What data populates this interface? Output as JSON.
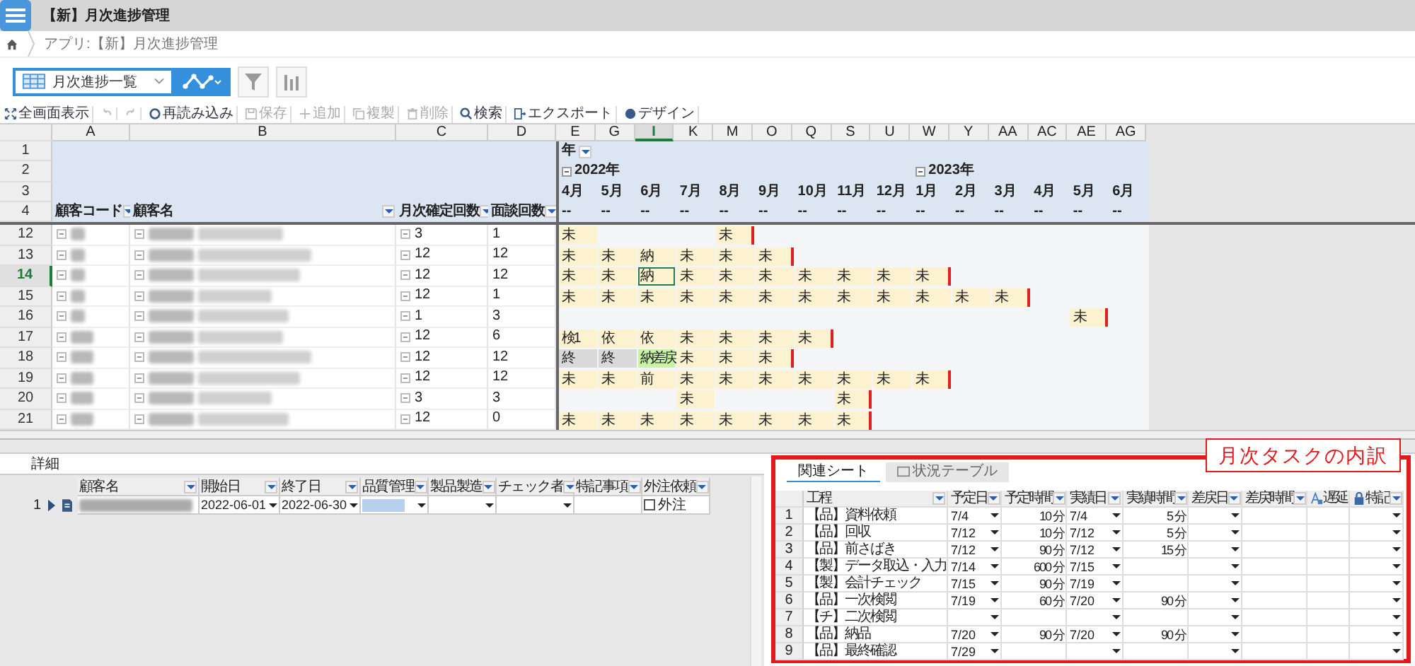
{
  "app": {
    "title": "【新】月次進捗管理",
    "breadcrumb": "アプリ:【新】月次進捗管理"
  },
  "view": {
    "name": "月次進捗一覧"
  },
  "toolbar": [
    {
      "kind": "expand",
      "label": "全画面表示",
      "disabled": false
    },
    {
      "kind": "undo",
      "disabled": true
    },
    {
      "kind": "redo",
      "disabled": true
    },
    {
      "kind": "reload",
      "label": "再読み込み",
      "disabled": false
    },
    {
      "kind": "save",
      "label": "保存",
      "disabled": true
    },
    {
      "kind": "add",
      "label": "追加",
      "disabled": true
    },
    {
      "kind": "copy",
      "label": "複製",
      "disabled": true
    },
    {
      "kind": "delete",
      "label": "削除",
      "disabled": true
    },
    {
      "kind": "search",
      "label": "検索",
      "disabled": false
    },
    {
      "kind": "export",
      "label": "エクスポート",
      "disabled": false
    },
    {
      "kind": "design",
      "label": "デザイン",
      "disabled": false
    }
  ],
  "sheet": {
    "header_rows": [
      "1",
      "2",
      "3",
      "4"
    ],
    "year_filter": "年",
    "fixed_columns": [
      {
        "letter": "A",
        "header": "顧客コード"
      },
      {
        "letter": "B",
        "header": "顧客名"
      },
      {
        "letter": "C",
        "header": "月次確定回数"
      },
      {
        "letter": "D",
        "header": "面談回数"
      }
    ],
    "month_columns": [
      {
        "letter": "E",
        "year": "2022年",
        "month": "4月",
        "sub": "--",
        "selected": false
      },
      {
        "letter": "G",
        "month": "5月",
        "sub": "--",
        "selected": false
      },
      {
        "letter": "I",
        "month": "6月",
        "sub": "--",
        "selected": true
      },
      {
        "letter": "K",
        "month": "7月",
        "sub": "--",
        "selected": false
      },
      {
        "letter": "M",
        "month": "8月",
        "sub": "--",
        "selected": false
      },
      {
        "letter": "O",
        "month": "9月",
        "sub": "--",
        "selected": false
      },
      {
        "letter": "Q",
        "month": "10月",
        "sub": "--",
        "selected": false
      },
      {
        "letter": "S",
        "month": "11月",
        "sub": "--",
        "selected": false
      },
      {
        "letter": "U",
        "month": "12月",
        "sub": "--",
        "selected": false
      },
      {
        "letter": "W",
        "year": "2023年",
        "month": "1月",
        "sub": "--",
        "selected": false
      },
      {
        "letter": "Y",
        "month": "2月",
        "sub": "--",
        "selected": false
      },
      {
        "letter": "AA",
        "month": "3月",
        "sub": "--",
        "selected": false
      },
      {
        "letter": "AC",
        "month": "4月",
        "sub": "--",
        "selected": false
      },
      {
        "letter": "AE",
        "month": "5月",
        "sub": "--",
        "selected": false
      },
      {
        "letter": "AG",
        "month": "6月",
        "sub": "--",
        "selected": false
      }
    ],
    "rows": [
      {
        "number": "12",
        "selected": false,
        "count": "3",
        "interviews": "1",
        "cells": [
          {
            "text": "未",
            "color": "#fdf2d0"
          },
          null,
          null,
          null,
          {
            "text": "未",
            "color": "#fdf2d0"
          },
          null,
          null,
          null,
          null,
          null,
          null,
          null,
          null,
          null,
          null
        ]
      },
      {
        "number": "13",
        "selected": false,
        "count": "12",
        "interviews": "12",
        "cells": [
          {
            "text": "未",
            "color": "#fdf2d0"
          },
          {
            "text": "未",
            "color": "#fdf2d0"
          },
          {
            "text": "納",
            "color": "#fdf2d0"
          },
          {
            "text": "未",
            "color": "#fdf2d0"
          },
          {
            "text": "未",
            "color": "#fdf2d0"
          },
          {
            "text": "未",
            "color": "#fdf2d0"
          },
          null,
          null,
          null,
          null,
          null,
          null,
          null,
          null,
          null
        ]
      },
      {
        "number": "14",
        "selected": true,
        "count": "12",
        "interviews": "12",
        "cells": [
          {
            "text": "未",
            "color": "#fdf2d0"
          },
          {
            "text": "未",
            "color": "#fdf2d0"
          },
          {
            "text": "納",
            "color": "#fdf2d0"
          },
          {
            "text": "未",
            "color": "#fdf2d0"
          },
          {
            "text": "未",
            "color": "#fdf2d0"
          },
          {
            "text": "未",
            "color": "#fdf2d0"
          },
          {
            "text": "未",
            "color": "#fdf2d0"
          },
          {
            "text": "未",
            "color": "#fdf2d0"
          },
          {
            "text": "未",
            "color": "#fdf2d0"
          },
          {
            "text": "未",
            "color": "#fdf2d0"
          },
          null,
          null,
          null,
          null,
          null
        ]
      },
      {
        "number": "15",
        "selected": false,
        "count": "12",
        "interviews": "1",
        "cells": [
          {
            "text": "未",
            "color": "#fdf2d0"
          },
          {
            "text": "未",
            "color": "#fdf2d0"
          },
          {
            "text": "未",
            "color": "#fdf2d0"
          },
          {
            "text": "未",
            "color": "#fdf2d0"
          },
          {
            "text": "未",
            "color": "#fdf2d0"
          },
          {
            "text": "未",
            "color": "#fdf2d0"
          },
          {
            "text": "未",
            "color": "#fdf2d0"
          },
          {
            "text": "未",
            "color": "#fdf2d0"
          },
          {
            "text": "未",
            "color": "#fdf2d0"
          },
          {
            "text": "未",
            "color": "#fdf2d0"
          },
          {
            "text": "未",
            "color": "#fdf2d0"
          },
          {
            "text": "未",
            "color": "#fdf2d0"
          },
          null,
          null,
          null
        ]
      },
      {
        "number": "16",
        "selected": false,
        "count": "1",
        "interviews": "3",
        "cells": [
          null,
          null,
          null,
          null,
          null,
          null,
          null,
          null,
          null,
          null,
          null,
          null,
          null,
          {
            "text": "未",
            "color": "#fdf2d0"
          },
          null
        ]
      },
      {
        "number": "17",
        "selected": false,
        "count": "12",
        "interviews": "6",
        "cells": [
          {
            "text": "検1",
            "color": "#fdf2d0"
          },
          {
            "text": "依",
            "color": "#fdf2d0"
          },
          {
            "text": "依",
            "color": "#fdf2d0"
          },
          {
            "text": "未",
            "color": "#fdf2d0"
          },
          {
            "text": "未",
            "color": "#fdf2d0"
          },
          {
            "text": "未",
            "color": "#fdf2d0"
          },
          {
            "text": "未",
            "color": "#fdf2d0"
          },
          null,
          null,
          null,
          null,
          null,
          null,
          null,
          null
        ]
      },
      {
        "number": "18",
        "selected": false,
        "count": "12",
        "interviews": "12",
        "cells": [
          {
            "text": "終",
            "color": "#d9d9d9"
          },
          {
            "text": "終",
            "color": "#d9d9d9"
          },
          {
            "text": "納差戻",
            "color": "#c8f2a4"
          },
          {
            "text": "未",
            "color": "#fdf2d0"
          },
          {
            "text": "未",
            "color": "#fdf2d0"
          },
          {
            "text": "未",
            "color": "#fdf2d0"
          },
          null,
          null,
          null,
          null,
          null,
          null,
          null,
          null,
          null
        ]
      },
      {
        "number": "19",
        "selected": false,
        "count": "12",
        "interviews": "12",
        "cells": [
          {
            "text": "未",
            "color": "#fdf2d0"
          },
          {
            "text": "未",
            "color": "#fdf2d0"
          },
          {
            "text": "前",
            "color": "#fdf2d0"
          },
          {
            "text": "未",
            "color": "#fdf2d0"
          },
          {
            "text": "未",
            "color": "#fdf2d0"
          },
          {
            "text": "未",
            "color": "#fdf2d0"
          },
          {
            "text": "未",
            "color": "#fdf2d0"
          },
          {
            "text": "未",
            "color": "#fdf2d0"
          },
          {
            "text": "未",
            "color": "#fdf2d0"
          },
          {
            "text": "未",
            "color": "#fdf2d0"
          },
          null,
          null,
          null,
          null,
          null
        ]
      },
      {
        "number": "20",
        "selected": false,
        "count": "3",
        "interviews": "3",
        "cells": [
          null,
          null,
          null,
          {
            "text": "未",
            "color": "#fdf2d0"
          },
          null,
          null,
          null,
          {
            "text": "未",
            "color": "#fdf2d0"
          },
          null,
          null,
          null,
          null,
          null,
          null,
          null
        ]
      },
      {
        "number": "21",
        "selected": false,
        "count": "12",
        "interviews": "0",
        "cells": [
          {
            "text": "未",
            "color": "#fdf2d0"
          },
          {
            "text": "未",
            "color": "#fdf2d0"
          },
          {
            "text": "未",
            "color": "#fdf2d0"
          },
          {
            "text": "未",
            "color": "#fdf2d0"
          },
          {
            "text": "未",
            "color": "#fdf2d0"
          },
          {
            "text": "未",
            "color": "#fdf2d0"
          },
          {
            "text": "未",
            "color": "#fdf2d0"
          },
          {
            "text": "未",
            "color": "#fdf2d0"
          },
          null,
          null,
          null,
          null,
          null,
          null,
          null
        ]
      }
    ]
  },
  "detail": {
    "tab": "詳細",
    "columns": [
      "顧客名",
      "開始日",
      "終了日",
      "品質管理",
      "製品製造",
      "チェック者",
      "特記事項",
      "外注依頼"
    ],
    "rows": [
      {
        "number": "1",
        "start": "2022-06-01",
        "end": "2022-06-30",
        "outsource": {
          "label": "外注",
          "checked": false
        }
      }
    ]
  },
  "tasks": {
    "callout": "月次タスクの内訳",
    "tabs": [
      {
        "label": "関連シート",
        "selected": true,
        "disabled": false
      },
      {
        "label": "状況テーブル",
        "selected": false,
        "disabled": true
      }
    ],
    "columns": [
      {
        "kind": "plain",
        "label": "工程"
      },
      {
        "kind": "plain",
        "label": "予定日"
      },
      {
        "kind": "plain",
        "label": "予定時間"
      },
      {
        "kind": "plain",
        "label": "実績日"
      },
      {
        "kind": "plain",
        "label": "実績時間"
      },
      {
        "kind": "plain",
        "label": "差戻日"
      },
      {
        "kind": "plain",
        "label": "差戻時間"
      },
      {
        "kind": "delay",
        "label": "遅延"
      },
      {
        "kind": "lock",
        "label": "特記"
      }
    ],
    "rows": [
      {
        "number": "1",
        "step": "【品】資料依頼",
        "plan_date": "7/4",
        "plan_time": "10 分",
        "actual_date": "7/4",
        "actual_time": "5 分"
      },
      {
        "number": "2",
        "step": "【品】回収",
        "plan_date": "7/12",
        "plan_time": "10 分",
        "actual_date": "7/12",
        "actual_time": "5 分"
      },
      {
        "number": "3",
        "step": "【品】前さばき",
        "plan_date": "7/12",
        "plan_time": "90 分",
        "actual_date": "7/12",
        "actual_time": "15 分"
      },
      {
        "number": "4",
        "step": "【製】データ取込・入力",
        "plan_date": "7/14",
        "plan_time": "600 分",
        "actual_date": "7/15"
      },
      {
        "number": "5",
        "step": "【製】会計チェック",
        "plan_date": "7/15",
        "plan_time": "90 分",
        "actual_date": "7/19"
      },
      {
        "number": "6",
        "step": "【品】一次検閲",
        "plan_date": "7/19",
        "plan_time": "60 分",
        "actual_date": "7/20",
        "actual_time": "90 分"
      },
      {
        "number": "7",
        "step": "【チ】二次検閲"
      },
      {
        "number": "8",
        "step": "【品】納品",
        "plan_date": "7/20",
        "plan_time": "90 分",
        "actual_date": "7/20",
        "actual_time": "90 分"
      },
      {
        "number": "9",
        "step": "【品】最終確認",
        "plan_date": "7/29"
      }
    ]
  }
}
